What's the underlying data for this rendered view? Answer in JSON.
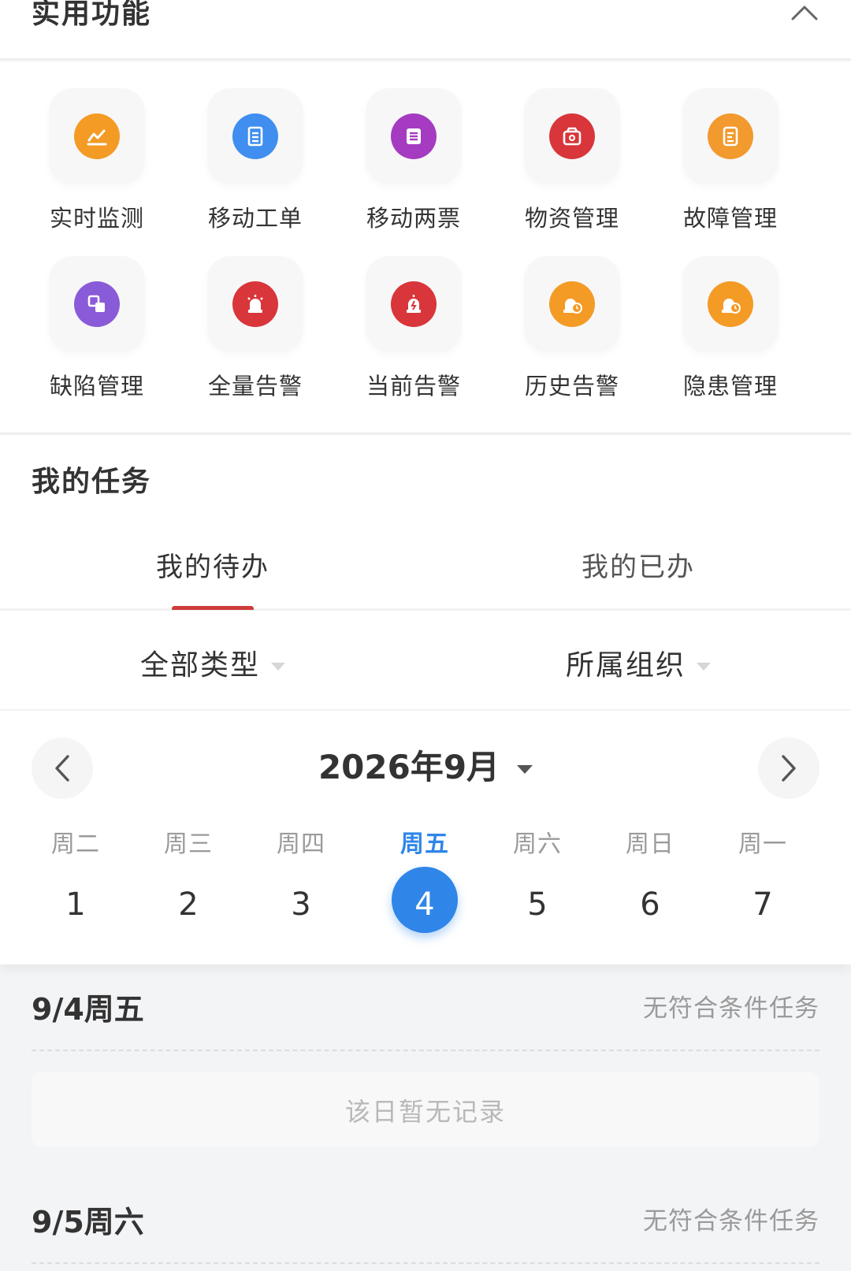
{
  "features": {
    "title": "实用功能",
    "items": [
      {
        "label": "实时监测",
        "icon": "chart-icon",
        "color": "#f39b25"
      },
      {
        "label": "移动工单",
        "icon": "document-icon",
        "color": "#3f8ef0"
      },
      {
        "label": "移动两票",
        "icon": "list-icon",
        "color": "#a53bc0"
      },
      {
        "label": "物资管理",
        "icon": "box-icon",
        "color": "#d8363a"
      },
      {
        "label": "故障管理",
        "icon": "clipboard-icon",
        "color": "#f29a2e"
      },
      {
        "label": "缺陷管理",
        "icon": "layers-icon",
        "color": "#8a5bd8"
      },
      {
        "label": "全量告警",
        "icon": "alarm-icon",
        "color": "#d8363a"
      },
      {
        "label": "当前告警",
        "icon": "alarm-flash-icon",
        "color": "#d8363a"
      },
      {
        "label": "历史告警",
        "icon": "alarm-clock-icon",
        "color": "#f39b25"
      },
      {
        "label": "隐患管理",
        "icon": "hazard-icon",
        "color": "#f39b25"
      }
    ]
  },
  "tasks": {
    "title": "我的任务",
    "tabs": [
      "我的待办",
      "我的已办"
    ],
    "active_tab": 0,
    "filters": [
      "全部类型",
      "所属组织"
    ]
  },
  "calendar": {
    "month_label": "2026年9月",
    "weekdays": [
      "周二",
      "周三",
      "周四",
      "周五",
      "周六",
      "周日",
      "周一"
    ],
    "days": [
      "1",
      "2",
      "3",
      "4",
      "5",
      "6",
      "7"
    ],
    "selected_index": 3,
    "accent_color": "#2f86e8"
  },
  "day_lists": [
    {
      "date": "9/4周五",
      "status": "无符合条件任务",
      "empty_message": "该日暂无记录"
    },
    {
      "date": "9/5周六",
      "status": "无符合条件任务"
    }
  ]
}
